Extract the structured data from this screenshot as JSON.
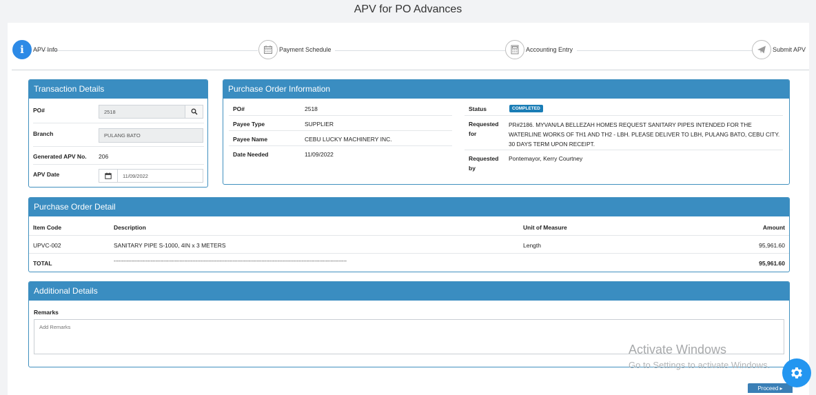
{
  "page": {
    "title": "APV for PO Advances"
  },
  "steps": [
    {
      "label": "APV Info",
      "icon": "info-icon"
    },
    {
      "label": "Payment Schedule",
      "icon": "calendar-icon"
    },
    {
      "label": "Accounting Entry",
      "icon": "calculator-icon"
    },
    {
      "label": "Submit APV",
      "icon": "send-icon"
    }
  ],
  "transaction": {
    "title": "Transaction Details",
    "po_label": "PO#",
    "po_value": "2518",
    "branch_label": "Branch",
    "branch_value": "PULANG BATO",
    "apv_no_label": "Generated APV No.",
    "apv_no_value": "206",
    "apv_date_label": "APV Date",
    "apv_date_value": "11/09/2022"
  },
  "po_info": {
    "title": "Purchase Order Information",
    "po_label": "PO#",
    "po_value": "2518",
    "payee_type_label": "Payee Type",
    "payee_type_value": "SUPPLIER",
    "payee_name_label": "Payee Name",
    "payee_name_value": "CEBU LUCKY MACHINERY INC.",
    "date_needed_label": "Date Needed",
    "date_needed_value": "11/09/2022",
    "status_label": "Status",
    "status_value": "COMPLETED",
    "requested_for_label_1": "Requested",
    "requested_for_label_2": "for",
    "requested_for_value": "PR#2186. MYVAN/LA BELLEZAH HOMES REQUEST SANITARY PIPES INTENDED FOR THE WATERLINE WORKS OF TH1 AND TH2 - LBH. PLEASE DELIVER TO LBH, PULANG BATO, CEBU CITY. 30 DAYS TERM UPON RECEIPT.",
    "requested_by_label_1": "Requested",
    "requested_by_label_2": "by",
    "requested_by_value": "Pontemayor, Kerry Courtney"
  },
  "po_detail": {
    "title": "Purchase Order Detail",
    "columns": [
      "Item Code",
      "Description",
      "Unit of Measure",
      "Amount"
    ],
    "rows": [
      {
        "item_code": "UPVC-002",
        "description": "SANITARY PIPE S-1000, 4IN x 3 METERS",
        "uom": "Length",
        "amount": "95,961.60"
      }
    ],
    "total_label": "TOTAL",
    "total_dashes": "-------------------------------------------------------------------------------------------------------------------------------------------------",
    "total_amount": "95,961.60"
  },
  "additional": {
    "title": "Additional Details",
    "remarks_label": "Remarks",
    "remarks_placeholder": "Add Remarks"
  },
  "watermark": {
    "line1": "Activate Windows",
    "line2": "Go to Settings to activate Windows."
  },
  "footer": {
    "proceed_label": "Proceed ▸"
  }
}
